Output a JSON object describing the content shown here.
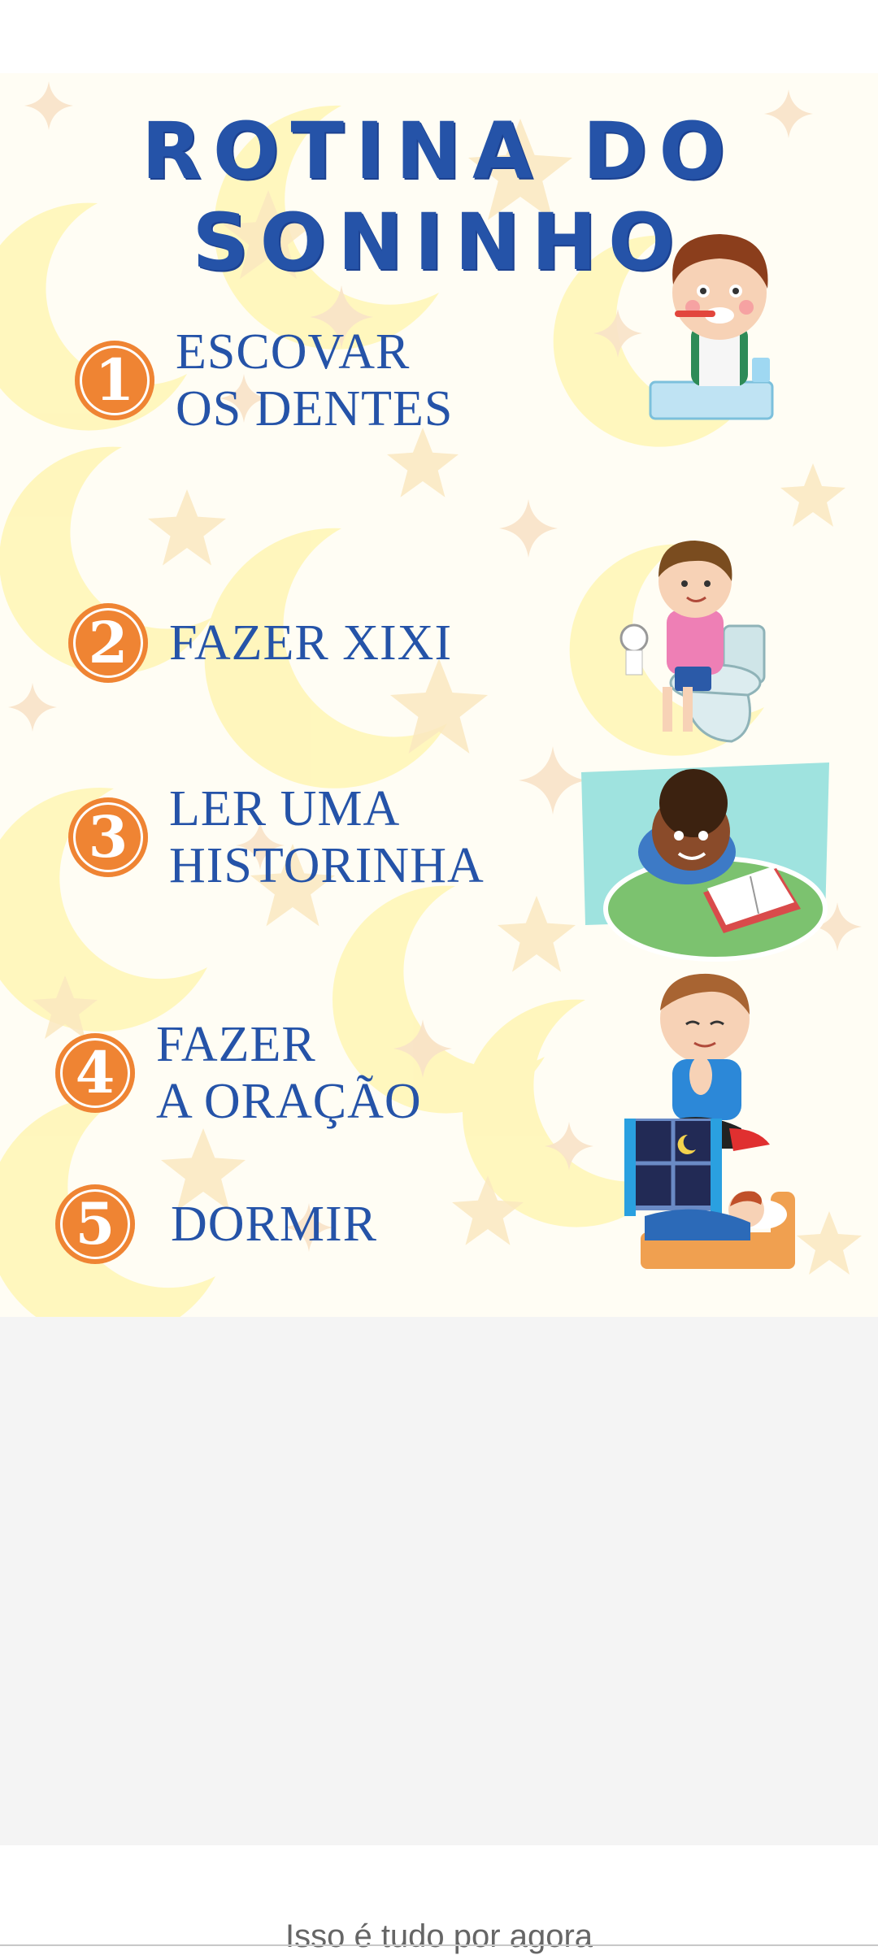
{
  "poster": {
    "title": "ROTINA DO SONINHO",
    "steps": [
      {
        "number": "1",
        "line1": "ESCOVAR",
        "line2": "OS DENTES",
        "illustration": "child-brushing-teeth"
      },
      {
        "number": "2",
        "line1": "FAZER XIXI",
        "line2": "",
        "illustration": "child-on-toilet"
      },
      {
        "number": "3",
        "line1": "LER UMA",
        "line2": "HISTORINHA",
        "illustration": "child-reading-book"
      },
      {
        "number": "4",
        "line1": "FAZER",
        "line2": "A ORAÇÃO",
        "illustration": "child-praying"
      },
      {
        "number": "5",
        "line1": "DORMIR",
        "line2": "",
        "illustration": "child-sleeping-bed"
      }
    ]
  },
  "footer": {
    "text": "Isso é tudo por agora"
  },
  "colors": {
    "title": "#2553a8",
    "badge": "#ef8433",
    "moon": "#fff4a8",
    "star": "#fbe8c0"
  }
}
